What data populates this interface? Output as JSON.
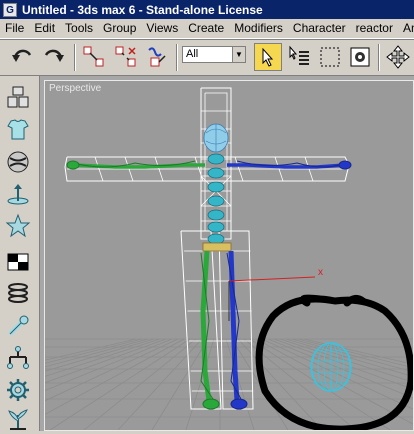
{
  "window": {
    "title": "Untitled - 3ds max 6 - Stand-alone License",
    "app_icon_letter": "G"
  },
  "menu": {
    "items": [
      "File",
      "Edit",
      "Tools",
      "Group",
      "Views",
      "Create",
      "Modifiers",
      "Character",
      "reactor",
      "Anima"
    ]
  },
  "toolbar": {
    "selection_filter": "All",
    "icons": [
      "undo-icon",
      "redo-icon",
      "select-and-link-icon",
      "unlink-selection-icon",
      "bind-to-space-warp-icon",
      "select-object-icon",
      "select-by-name-icon",
      "rectangular-selection-region-icon",
      "window-crossing-icon",
      "select-and-move-icon"
    ]
  },
  "left_toolbar": {
    "icons": [
      "create-objects-icon",
      "cloth-icon",
      "material-sphere-icon",
      "particle-icon",
      "helper-star-icon",
      "checker-icon",
      "spring-icon",
      "wrench-icon",
      "hierarchy-icon",
      "gear-icon",
      "plant-icon"
    ]
  },
  "viewport": {
    "label": "Perspective",
    "colors": {
      "background": "#9a9a9a",
      "grid": "#8c8c8c",
      "bounding_box": "#ffffff",
      "left_arm": "#2aa83a",
      "right_arm": "#2338c8",
      "spine": "#35b5c8",
      "head": "#8fd0ee",
      "annotation_circle": "#000000",
      "egg": "#2fc8e8",
      "axis_x": "#d42020"
    },
    "axis_label": "x"
  }
}
